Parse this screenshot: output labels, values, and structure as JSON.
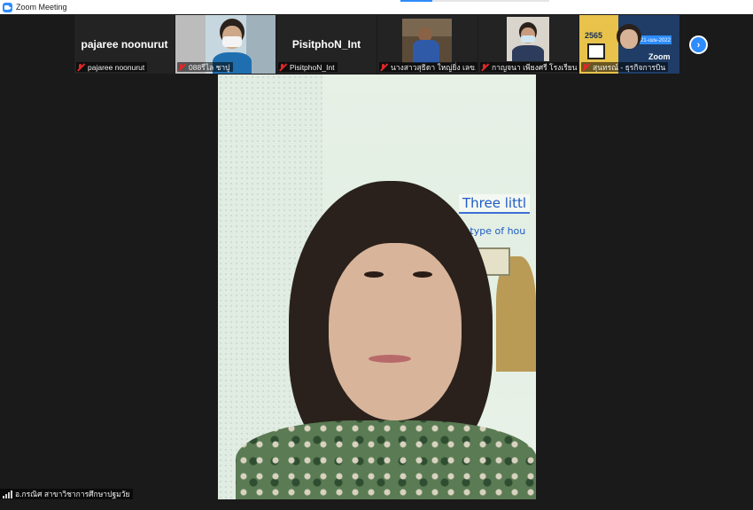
{
  "window": {
    "title": "Zoom Meeting",
    "icon": "zoom-app-icon"
  },
  "strip": {
    "participants": [
      {
        "display": "pajaree noonurut",
        "name": "pajaree noonurut",
        "muted": true,
        "video": false
      },
      {
        "display": "",
        "name": "088รีไล ชาปู",
        "muted": true,
        "video": true
      },
      {
        "display": "PisitphoN_Int",
        "name": "PisitphoN_Int",
        "muted": true,
        "video": false
      },
      {
        "display": "",
        "name": "นางสาวสุธิดา ใหญ่ยิ่ง เลข...",
        "muted": true,
        "video": true
      },
      {
        "display": "",
        "name": "กาญจนา เพียงศรี โรงเรียน...",
        "muted": true,
        "video": true
      },
      {
        "display": "",
        "name": "สุนทรณ์ - ธุรกิจการบิน",
        "muted": true,
        "video": true,
        "poster_date": "21-เมษ-2022",
        "poster_year": "2565",
        "poster_brand": "Zoom"
      }
    ],
    "next_icon": "chevron-right-icon"
  },
  "active_speaker": {
    "name": "อ.กรณิศ สาขาวิชาการศึกษาปฐมวัย",
    "board_title": "Three littl",
    "board_subtitle": "What type of hou"
  }
}
